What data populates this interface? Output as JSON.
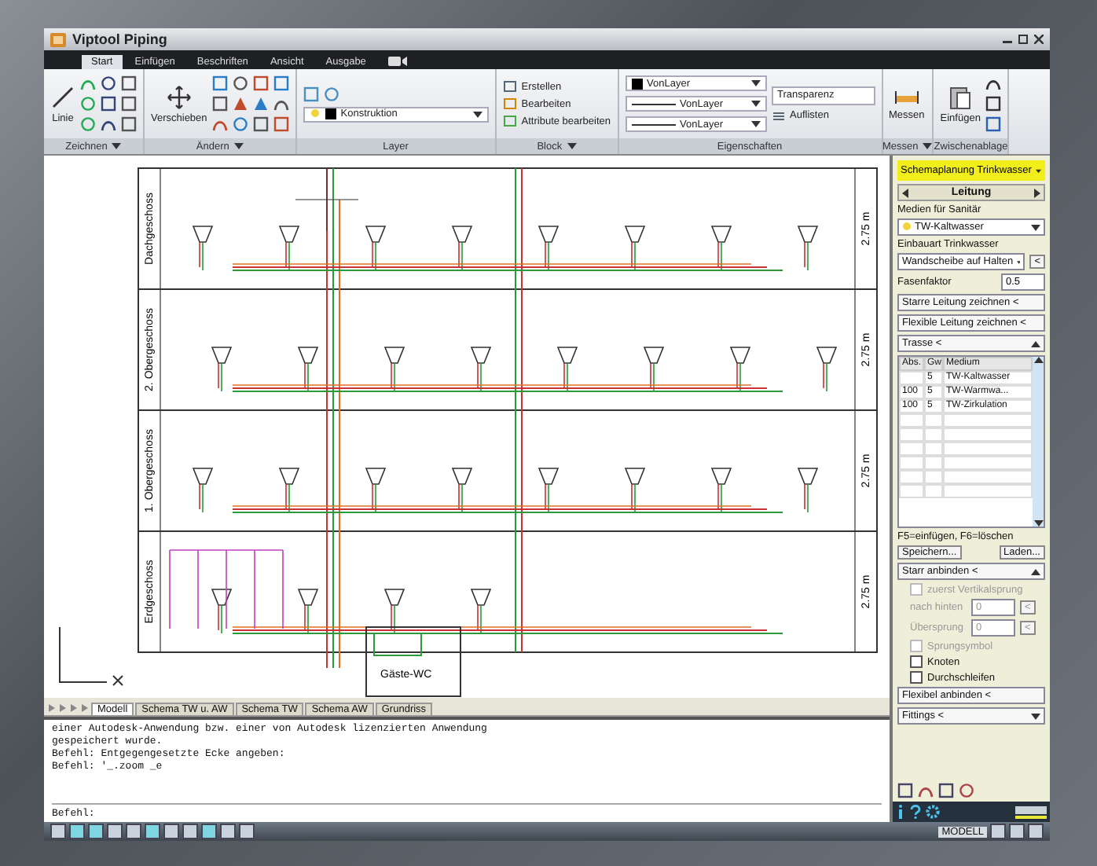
{
  "window": {
    "title": "Viptool Piping"
  },
  "ribbon_tabs": [
    {
      "label": "Start",
      "selected": true
    },
    {
      "label": "Einfügen",
      "selected": false
    },
    {
      "label": "Beschriften",
      "selected": false
    },
    {
      "label": "Ansicht",
      "selected": false
    },
    {
      "label": "Ausgabe",
      "selected": false
    }
  ],
  "ribbon": {
    "draw": {
      "title": "Zeichnen",
      "button": "Linie"
    },
    "modify": {
      "title": "Ändern",
      "button": "Verschieben"
    },
    "layer": {
      "title": "Layer",
      "current": "Konstruktion"
    },
    "block": {
      "title": "Block",
      "items": [
        "Erstellen",
        "Bearbeiten",
        "Attribute bearbeiten"
      ]
    },
    "properties": {
      "title": "Eigenschaften",
      "color_setting": "VonLayer",
      "linetype": "VonLayer",
      "lineweight": "VonLayer",
      "transparency": "Transparenz",
      "list": "Auflisten"
    },
    "measure": {
      "title": "Messen",
      "button": "Messen"
    },
    "clipboard": {
      "title": "Zwischenablage",
      "button": "Einfügen"
    }
  },
  "drawing": {
    "floors": [
      {
        "name": "Dachgeschoss",
        "height": "2.75 m"
      },
      {
        "name": "2. Obergeschoss",
        "height": "2.75 m"
      },
      {
        "name": "1. Obergeschoss",
        "height": "2.75 m"
      },
      {
        "name": "Erdgeschoss",
        "height": "2.75 m"
      }
    ],
    "room": "Gäste-WC"
  },
  "layout_tabs": [
    {
      "label": "Modell",
      "selected": true
    },
    {
      "label": "Schema TW u. AW",
      "selected": false
    },
    {
      "label": "Schema TW",
      "selected": false
    },
    {
      "label": "Schema AW",
      "selected": false
    },
    {
      "label": "Grundriss",
      "selected": false
    }
  ],
  "command_history": [
    "einer Autodesk-Anwendung bzw. einer von Autodesk lizenzierten Anwendung",
    "gespeichert wurde.",
    "Befehl: Entgegengesetzte Ecke angeben:",
    "Befehl: '_.zoom _e"
  ],
  "command_prompt": "Befehl:",
  "side_panel": {
    "mode": "Schemaplanung Trinkwasser",
    "section": "Leitung",
    "media_label": "Medien für Sanitär",
    "media": "TW-Kaltwasser",
    "install_label": "Einbauart Trinkwasser",
    "install": "Wandscheibe auf Halten",
    "install_button": "<",
    "factor_label": "Fasenfaktor",
    "factor": "0.5",
    "draw_buttons": [
      "Starre Leitung zeichnen <",
      "Flexible Leitung zeichnen <"
    ],
    "route": {
      "title": "Trasse <",
      "expanded": true
    },
    "columns": [
      "Abs.",
      "Gw",
      "Medium"
    ],
    "rows": [
      [
        "",
        "5",
        "TW-Kaltwasser"
      ],
      [
        "100",
        "5",
        "TW-Warmwa..."
      ],
      [
        "100",
        "5",
        "TW-Zirkulation"
      ]
    ],
    "hint": "F5=einfügen, F6=löschen",
    "buttons": [
      "Speichern...",
      "Laden..."
    ],
    "rigid": {
      "title": "Starr anbinden <",
      "expanded": true
    },
    "options": [
      {
        "kind": "checkbox",
        "label": "zuerst Vertikalsprung",
        "checked": false,
        "disabled": true
      },
      {
        "kind": "field",
        "label": "nach hinten",
        "value": "0",
        "button": "<",
        "disabled": true
      },
      {
        "kind": "field",
        "label": "Übersprung",
        "value": "0",
        "button": "<",
        "disabled": true
      },
      {
        "kind": "checkbox",
        "label": "Sprungsymbol",
        "checked": false,
        "disabled": true
      },
      {
        "kind": "checkbox",
        "label": "Knoten",
        "checked": false,
        "disabled": false
      },
      {
        "kind": "checkbox",
        "label": "Durchschleifen",
        "checked": false,
        "disabled": false
      }
    ],
    "flex": "Flexibel anbinden <",
    "fittings": {
      "title": "Fittings <",
      "expanded": false
    }
  },
  "status": {
    "space": "MODELL"
  }
}
